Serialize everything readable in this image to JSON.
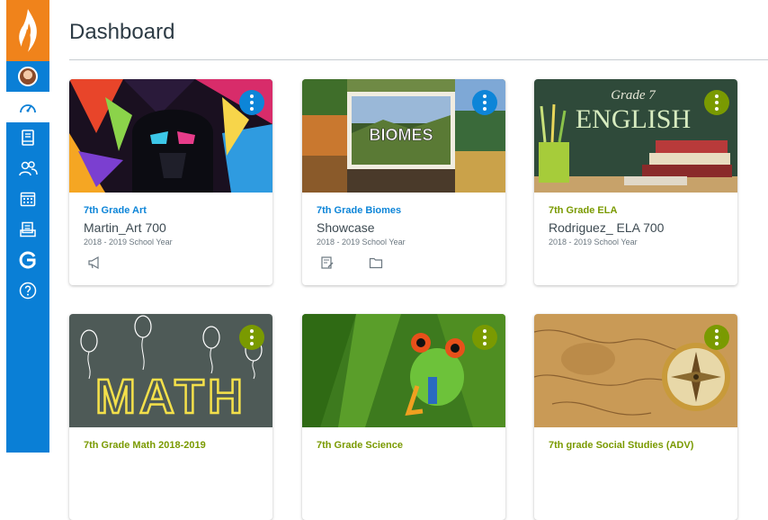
{
  "page": {
    "title": "Dashboard"
  },
  "nav": {
    "items": [
      {
        "icon": "account-avatar-icon"
      },
      {
        "icon": "dashboard-icon",
        "active": true
      },
      {
        "icon": "courses-icon"
      },
      {
        "icon": "groups-icon"
      },
      {
        "icon": "calendar-icon"
      },
      {
        "icon": "inbox-icon"
      },
      {
        "icon": "commons-icon"
      },
      {
        "icon": "help-icon"
      }
    ]
  },
  "cards": [
    {
      "name": "7th Grade Art",
      "code": "Martin_Art 700",
      "term": "2018 - 2019 School Year",
      "color": "#0d85d8",
      "kebab": "#0d85d8",
      "hero_text": "",
      "actions": [
        "announcements-icon"
      ]
    },
    {
      "name": "7th Grade Biomes",
      "code": "Showcase",
      "term": "2018 - 2019 School Year",
      "color": "#0d85d8",
      "kebab": "#0d85d8",
      "hero_text": "BIOMES",
      "actions": [
        "assignments-icon",
        "files-icon"
      ]
    },
    {
      "name": "7th Grade ELA",
      "code": "Rodriguez_ ELA 700",
      "term": "2018 - 2019 School Year",
      "color": "#7a9a01",
      "kebab": "#7a9a01",
      "hero_text": "Grade 7",
      "hero_text2": "ENGLISH",
      "actions": []
    },
    {
      "name": "7th Grade Math 2018-2019",
      "code": "",
      "term": "",
      "color": "#7a9a01",
      "kebab": "#7a9a01",
      "hero_text": "MATH",
      "actions": []
    },
    {
      "name": "7th Grade Science",
      "code": "",
      "term": "",
      "color": "#7a9a01",
      "kebab": "#7a9a01",
      "hero_text": "",
      "actions": []
    },
    {
      "name": "7th grade Social Studies (ADV)",
      "code": "",
      "term": "",
      "color": "#7a9a01",
      "kebab": "#7a9a01",
      "hero_text": "",
      "actions": []
    }
  ]
}
